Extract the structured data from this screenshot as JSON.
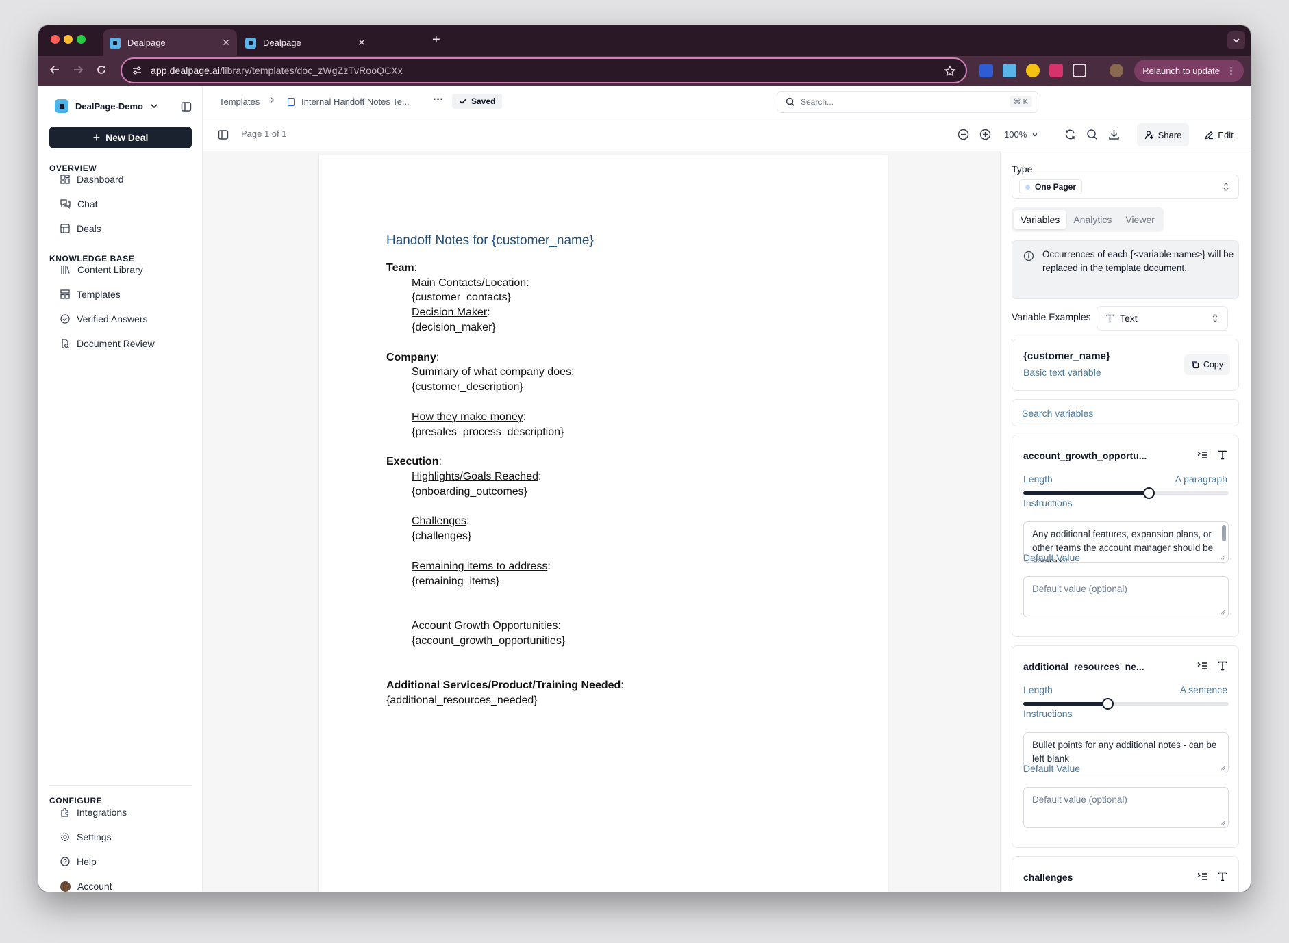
{
  "browser": {
    "tabs": [
      {
        "title": "Dealpage"
      },
      {
        "title": "Dealpage"
      }
    ],
    "url_host": "app.dealpage.ai",
    "url_path": "/library/templates/doc_zWgZzTvRooQCXx",
    "relaunch_label": "Relaunch to update"
  },
  "sidebar": {
    "workspace": "DealPage-Demo",
    "new_deal": "New Deal",
    "sections": {
      "overview": "OVERVIEW",
      "knowledge": "KNOWLEDGE BASE",
      "configure": "CONFIGURE"
    },
    "overview_items": [
      "Dashboard",
      "Chat",
      "Deals"
    ],
    "knowledge_items": [
      "Content Library",
      "Templates",
      "Verified Answers",
      "Document Review"
    ],
    "configure_items": [
      "Integrations",
      "Settings",
      "Help",
      "Account"
    ]
  },
  "header": {
    "breadcrumb_root": "Templates",
    "breadcrumb_doc": "Internal Handoff Notes Te...",
    "saved_label": "Saved",
    "search_placeholder": "Search...",
    "search_shortcut": "⌘ K"
  },
  "viewbar": {
    "page_label": "Page 1 of 1",
    "zoom": "100%",
    "share_label": "Share",
    "edit_label": "Edit"
  },
  "document": {
    "title": "Handoff Notes for {customer_name}",
    "team_heading": "Team",
    "team_contacts_label": "Main Contacts/Location",
    "team_contacts_var": "{customer_contacts}",
    "team_decision_label": "Decision Maker",
    "team_decision_var": "{decision_maker}",
    "company_heading": "Company",
    "company_summary_label": "Summary of what company does",
    "company_summary_var": "{customer_description}",
    "company_money_label": "How they make money",
    "company_money_var": "{presales_process_description}",
    "execution_heading": "Execution",
    "exec_highlights_label": "Highlights/Goals Reached",
    "exec_highlights_var": "{onboarding_outcomes}",
    "exec_challenges_label": "Challenges",
    "exec_challenges_var": "{challenges}",
    "exec_remaining_label": "Remaining items to address",
    "exec_remaining_var": "{remaining_items}",
    "exec_growth_label": "Account Growth Opportunities",
    "exec_growth_var": "{account_growth_opportunities}",
    "additional_heading": "Additional Services/Product/Training Needed",
    "additional_var": "{additional_resources_needed}"
  },
  "panel": {
    "type_label": "Type",
    "type_value": "One Pager",
    "tabs": [
      "Variables",
      "Analytics",
      "Viewer"
    ],
    "info_text": "Occurrences of each {<variable name>} will be replaced in the template document.",
    "examples_label": "Variable Examples",
    "examples_type": "Text",
    "example_var": "{customer_name}",
    "example_desc": "Basic text variable",
    "copy_label": "Copy",
    "search_vars_placeholder": "Search variables",
    "length_label": "Length",
    "instructions_label": "Instructions",
    "default_label": "Default Value",
    "default_placeholder": "Default value (optional)",
    "variables": [
      {
        "name": "account_growth_opportu...",
        "length": "A paragraph",
        "slider": 0.61,
        "instructions": "Any additional features, expansion plans, or other teams the account manager should be aware of"
      },
      {
        "name": "additional_resources_ne...",
        "length": "A sentence",
        "slider": 0.41,
        "instructions": "Bullet points for any additional notes - can be left blank"
      },
      {
        "name": "challenges"
      }
    ]
  },
  "colors": {
    "tabbar": "#2b1826",
    "toolbar": "#4a2c40",
    "primary_button": "#1a2230",
    "doc_title": "#1f4e79"
  }
}
